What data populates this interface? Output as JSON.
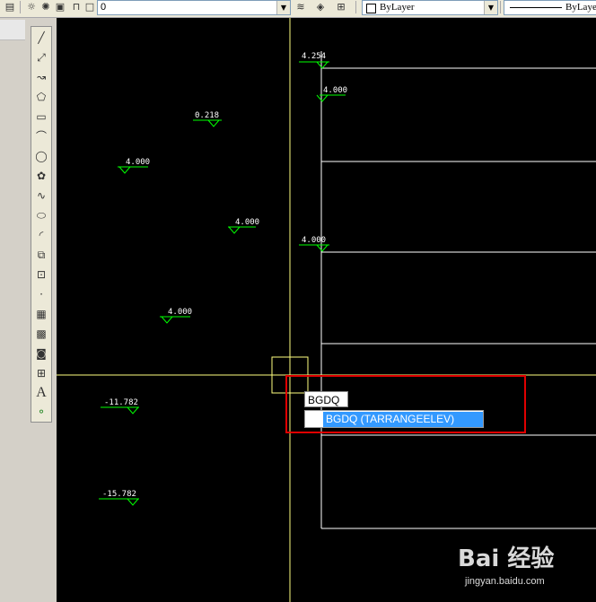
{
  "toolbar": {
    "layer_name": "0",
    "color_value": "ByLayer",
    "linetype_value": "ByLaye"
  },
  "draw_toolbar": {
    "tools": [
      "line",
      "construction-line",
      "polyline",
      "polygon",
      "rectangle",
      "arc",
      "circle",
      "revision-cloud",
      "spline",
      "ellipse",
      "ellipse-arc",
      "insert-block",
      "make-block",
      "point",
      "hatch",
      "gradient",
      "region",
      "table",
      "multiline-text",
      "add-selected"
    ]
  },
  "elevations": [
    {
      "id": "e1",
      "text": "4.254"
    },
    {
      "id": "e2",
      "text": "4.000"
    },
    {
      "id": "e3",
      "text": "0.218"
    },
    {
      "id": "e4",
      "text": "4.000"
    },
    {
      "id": "e5",
      "text": "4.000"
    },
    {
      "id": "e6",
      "text": "4.000"
    },
    {
      "id": "e7",
      "text": "4.000"
    },
    {
      "id": "e8",
      "text": "-11.782"
    },
    {
      "id": "e9",
      "text": "-15.782"
    }
  ],
  "command": {
    "input_text": "BGDQ",
    "suggestion": "BGDQ (TARRANGEELEV)"
  },
  "watermark": {
    "logo_text": "Bai 经验",
    "url": "jingyan.baidu.com"
  },
  "colors": {
    "canvas": "#000000",
    "marker_green": "#00ff00",
    "crosshair_yellow": "#ffff80",
    "highlight_red": "#e00000",
    "suggestion_blue": "#3399ff"
  }
}
